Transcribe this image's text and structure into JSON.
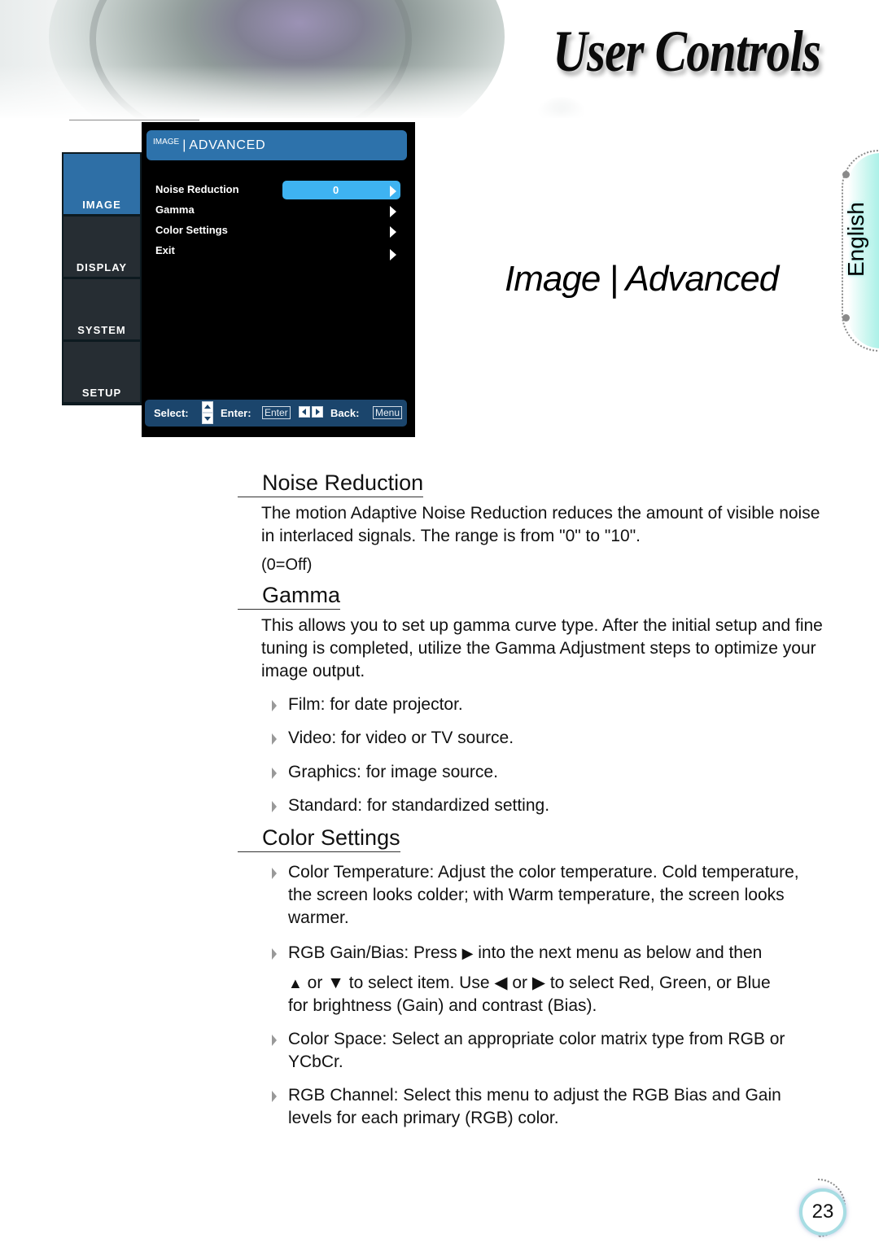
{
  "header": {
    "chapter_title": "User Controls"
  },
  "osd": {
    "header": {
      "crumb_parent": "IMAGE",
      "separator": "|",
      "crumb_current": "ADVANCED"
    },
    "side_tabs": [
      {
        "label": "IMAGE",
        "active": true
      },
      {
        "label": "DISPLAY",
        "active": false
      },
      {
        "label": "SYSTEM",
        "active": false
      },
      {
        "label": "SETUP",
        "active": false
      }
    ],
    "items": [
      {
        "label": "Noise Reduction",
        "value": "0",
        "selected": true,
        "icon": "chevron-right-icon"
      },
      {
        "label": "Gamma",
        "icon": "chevron-right-icon"
      },
      {
        "label": "Color Settings",
        "icon": "chevron-right-icon"
      },
      {
        "label": "Exit",
        "icon": "chevron-right-icon"
      }
    ],
    "footer": {
      "select_label": "Select:",
      "enter_label": "Enter:",
      "enter_key": "Enter",
      "back_label": "Back:",
      "back_key": "Menu"
    }
  },
  "section_title": "Image | Advanced",
  "language_tab": "English",
  "content": {
    "noise_reduction": {
      "title": "Noise Reduction",
      "paragraph": "The motion Adaptive Noise Reduction reduces the amount of visible noise in interlaced signals. The range is from \"0\" to \"10\".",
      "note": "(0=Off)"
    },
    "gamma": {
      "title": "Gamma",
      "paragraph": "This allows you to set up gamma curve type. After the initial setup and fine tuning is completed, utilize the Gamma Adjustment steps to optimize your image output.",
      "bullets": [
        "Film: for date projector.",
        "Video: for video or TV source.",
        "Graphics: for image source.",
        "Standard: for standardized setting."
      ]
    },
    "color_settings": {
      "title": "Color Settings",
      "bullets": {
        "color_temperature": "Color Temperature: Adjust the color temperature. Cold temperature, the screen looks colder; with Warm temperature, the screen looks warmer.",
        "rgb_gain_bias_line1_a": "RGB Gain/Bias: Press ",
        "rgb_gain_bias_line1_b": " into the next menu as below and then",
        "rgb_gain_bias_line2": " or ▼ to select item. Use ◀ or ▶ to select Red, Green, or Blue for brightness (Gain) and contrast (Bias).",
        "color_space": "Color Space: Select an appropriate color matrix type from RGB or YCbCr.",
        "rgb_channel": "RGB Channel: Select this menu to adjust the RGB Bias and Gain levels for each primary (RGB) color."
      },
      "glyphs": {
        "right": "▶",
        "up": "▲"
      }
    }
  },
  "page_number": "23",
  "colors": {
    "osd_header": "#2d72ab",
    "osd_selected": "#3eb3f1",
    "osd_footer": "#1b456c",
    "side_active": "#2e6fa6",
    "side_inactive": "#262d33",
    "lang_tab": "#7ee9de"
  }
}
